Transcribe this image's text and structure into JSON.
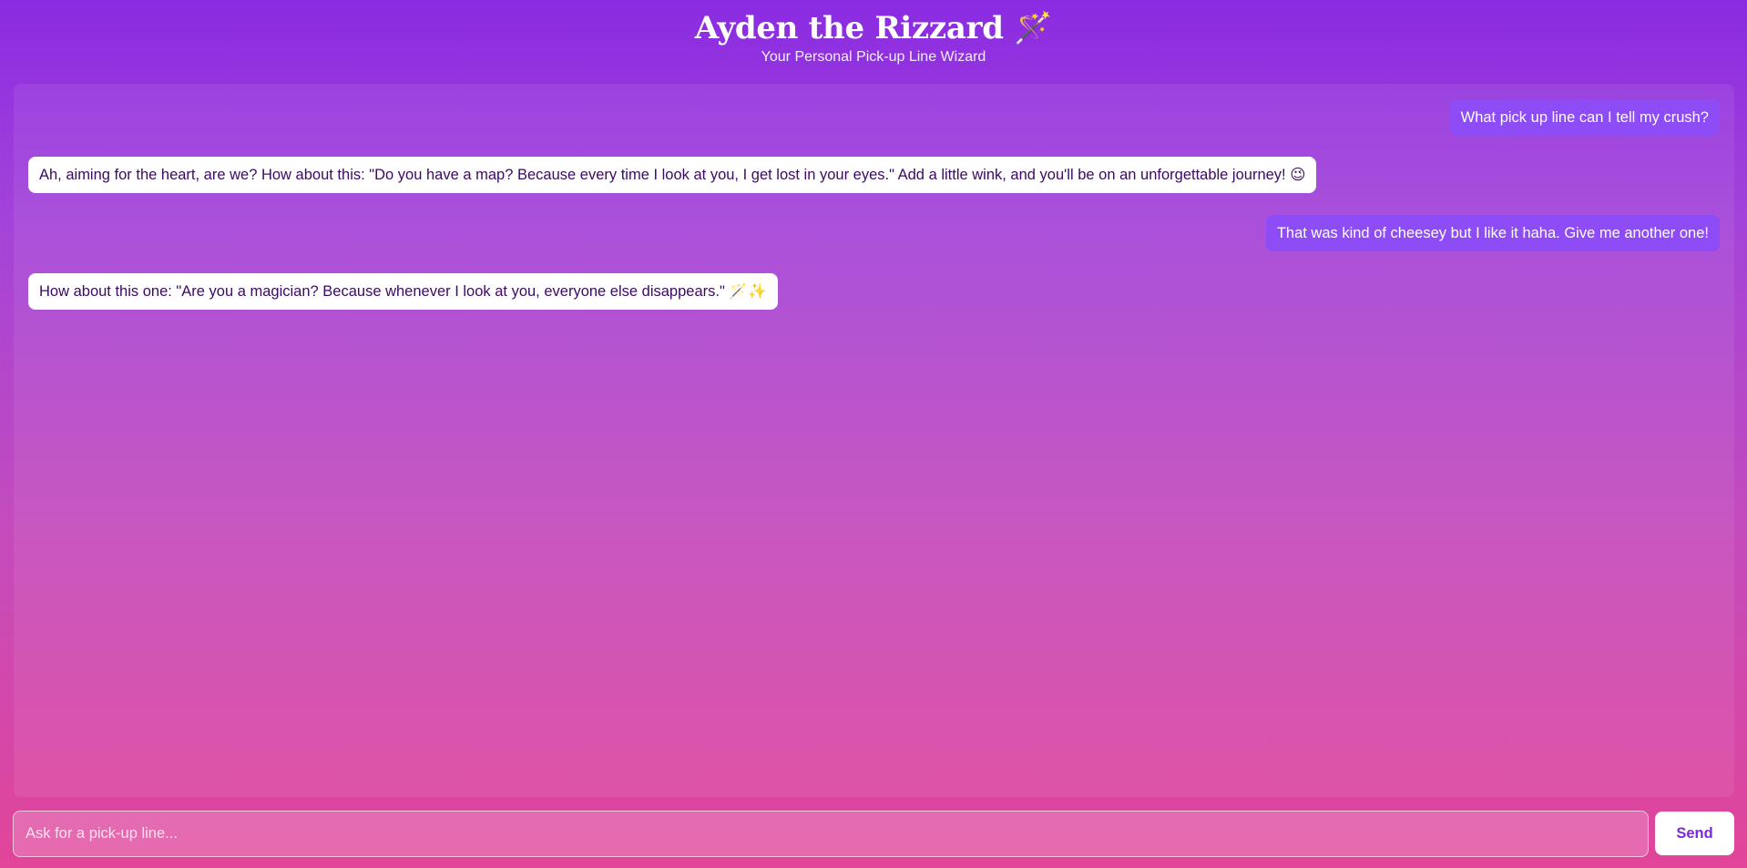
{
  "header": {
    "title": "Ayden the Rizzard 🪄",
    "subtitle": "Your Personal Pick-up Line Wizard"
  },
  "messages": [
    {
      "role": "user",
      "text": "What pick up line can I tell my crush?"
    },
    {
      "role": "bot",
      "text": "Ah, aiming for the heart, are we? How about this: \"Do you have a map? Because every time I look at you, I get lost in your eyes.\" Add a little wink, and you'll be on an unforgettable journey! 😉"
    },
    {
      "role": "user",
      "text": "That was kind of cheesey but I like it haha. Give me another one!"
    },
    {
      "role": "bot",
      "text": "How about this one: \"Are you a magician? Because whenever I look at you, everyone else disappears.\" 🪄✨"
    }
  ],
  "composer": {
    "placeholder": "Ask for a pick-up line...",
    "value": "",
    "send_label": "Send"
  },
  "colors": {
    "gradient_top": "#8a2be2",
    "gradient_bottom": "#e24599",
    "user_bubble": "#8d4cf5",
    "bot_bubble": "#ffffff",
    "bot_text": "#3b0a63",
    "send_text": "#7e26d9"
  }
}
